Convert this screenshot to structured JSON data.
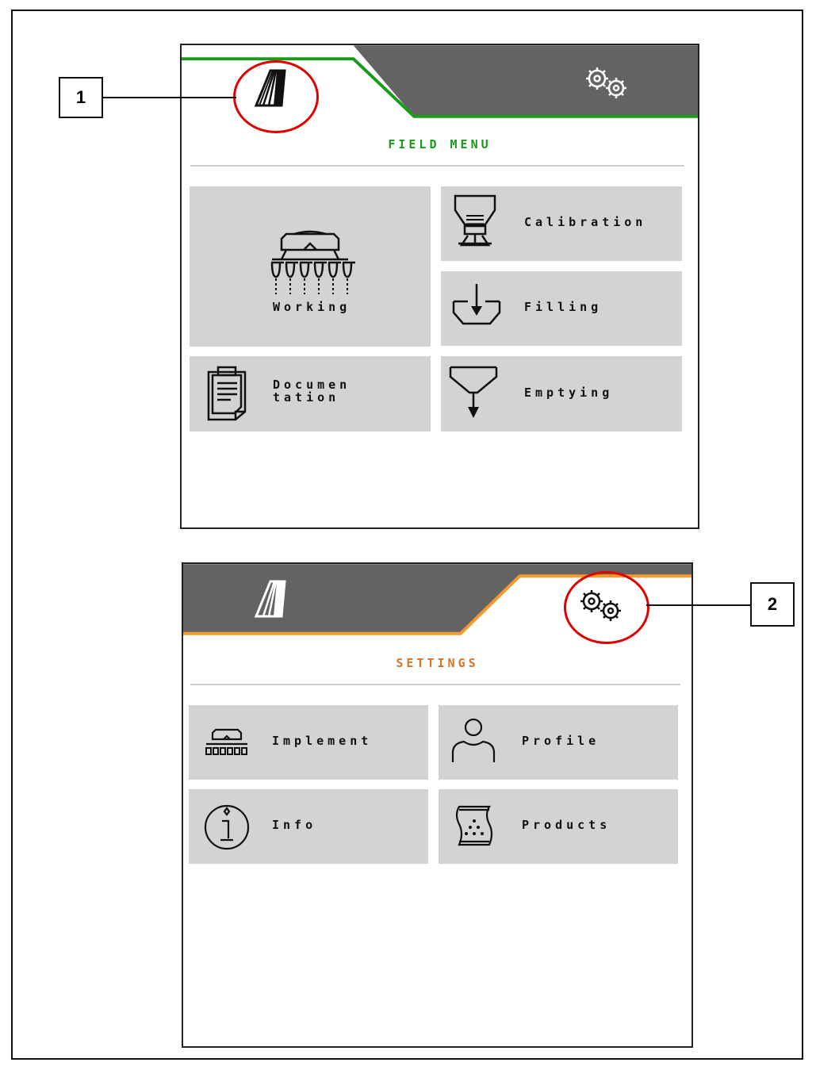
{
  "field_screen": {
    "title": "FIELD MENU",
    "tab_field_icon": "field-menu-icon",
    "tab_settings_icon": "gears-icon",
    "accent": "#1a9a1a",
    "tiles": {
      "working": "Working",
      "documentation": "Documen\ntation",
      "calibration": "Calibration",
      "filling": "Filling",
      "emptying": "Emptying"
    }
  },
  "settings_screen": {
    "title": "SETTINGS",
    "tab_field_icon": "field-menu-icon",
    "tab_settings_icon": "gears-icon",
    "accent": "#f39a2e",
    "tiles": {
      "implement": "Implement",
      "profile": "Profile",
      "info": "Info",
      "products": "Products"
    }
  },
  "callouts": {
    "one": "1",
    "two": "2"
  },
  "colors": {
    "header_gray": "#636363",
    "tile_gray": "#d3d3d3",
    "highlight_red": "#e00000",
    "settings_title": "#d4752a"
  }
}
